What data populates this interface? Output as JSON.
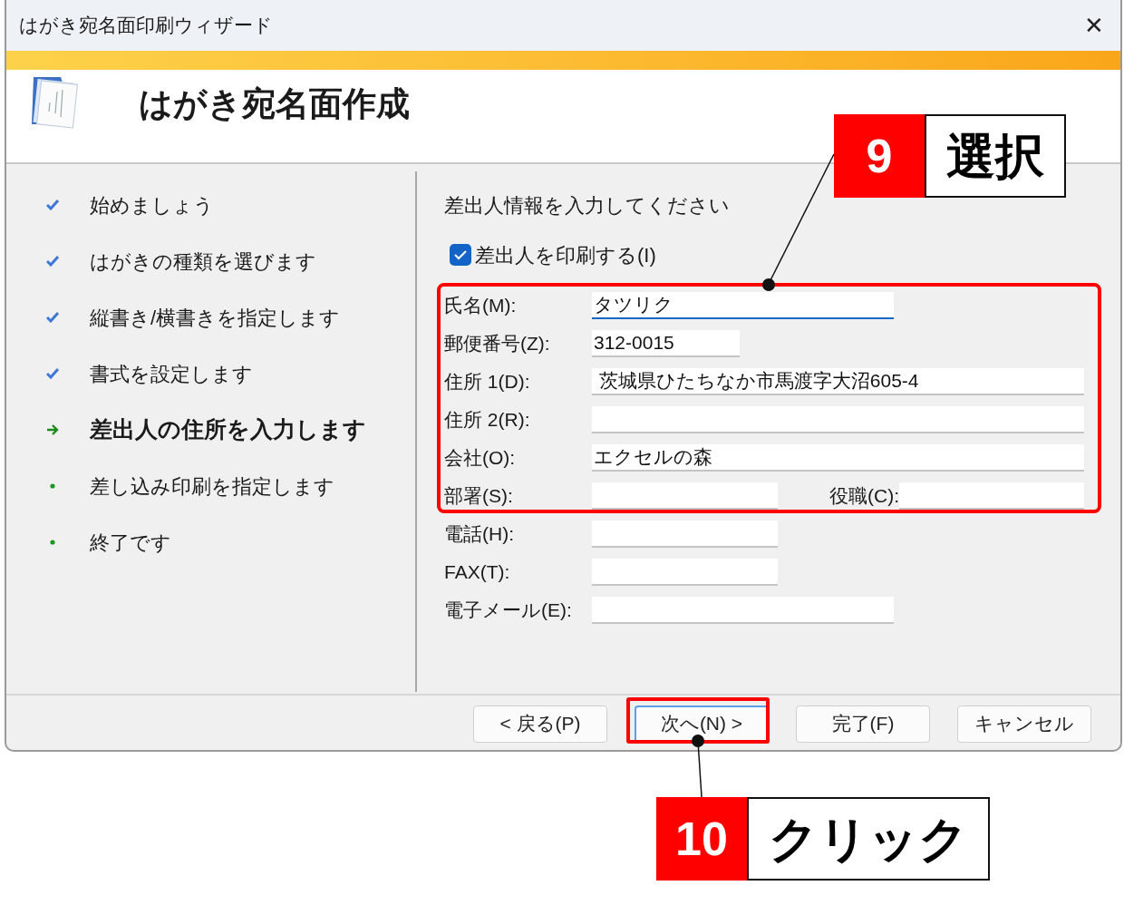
{
  "window": {
    "title": "はがき宛名面印刷ウィザード",
    "close": "✕"
  },
  "header": {
    "title": "はがき宛名面作成"
  },
  "steps": [
    {
      "label": "始めましょう",
      "kind": "done"
    },
    {
      "label": "はがきの種類を選びます",
      "kind": "done"
    },
    {
      "label": "縦書き/横書きを指定します",
      "kind": "done"
    },
    {
      "label": "書式を設定します",
      "kind": "done"
    },
    {
      "label": "差出人の住所を入力します",
      "kind": "current"
    },
    {
      "label": "差し込み印刷を指定します",
      "kind": "pending"
    },
    {
      "label": "終了です",
      "kind": "pending"
    }
  ],
  "form": {
    "heading": "差出人情報を入力してください",
    "print_sender": {
      "label": "差出人を印刷する(I)",
      "checked": true
    },
    "rows": [
      {
        "fields": [
          {
            "label": "氏名(M):",
            "value": "タツリク",
            "focused": true
          }
        ]
      },
      {
        "fields": [
          {
            "label": "郵便番号(Z):",
            "value": "312-0015",
            "focused": false
          }
        ]
      },
      {
        "fields": [
          {
            "label": "住所 1(D):",
            "value": " 茨城県ひたちなか市馬渡字大沼605-4",
            "focused": false
          }
        ]
      },
      {
        "fields": [
          {
            "label": "住所 2(R):",
            "focused": false
          }
        ]
      },
      {
        "fields": [
          {
            "label": "会社(O):",
            "value": "エクセルの森",
            "focused": false
          }
        ]
      },
      {
        "fields": [
          {
            "label": "部署(S):",
            "focused": false
          },
          {
            "label": "役職(C):",
            "focused": false
          }
        ]
      },
      {
        "fields": [
          {
            "label": "電話(H):",
            "focused": false
          }
        ]
      },
      {
        "fields": [
          {
            "label": "FAX(T):",
            "focused": false
          }
        ]
      },
      {
        "fields": [
          {
            "label": "電子メール(E):",
            "focused": false
          }
        ]
      }
    ]
  },
  "buttons": [
    {
      "label": "< 戻る(P)",
      "default": false
    },
    {
      "label": "次へ(N) >",
      "default": true
    },
    {
      "label": "完了(F)",
      "default": false
    },
    {
      "label": "キャンセル",
      "default": false
    }
  ],
  "annotations": [
    {
      "number": "9",
      "text": "選択"
    },
    {
      "number": "10",
      "text": "クリック"
    }
  ]
}
